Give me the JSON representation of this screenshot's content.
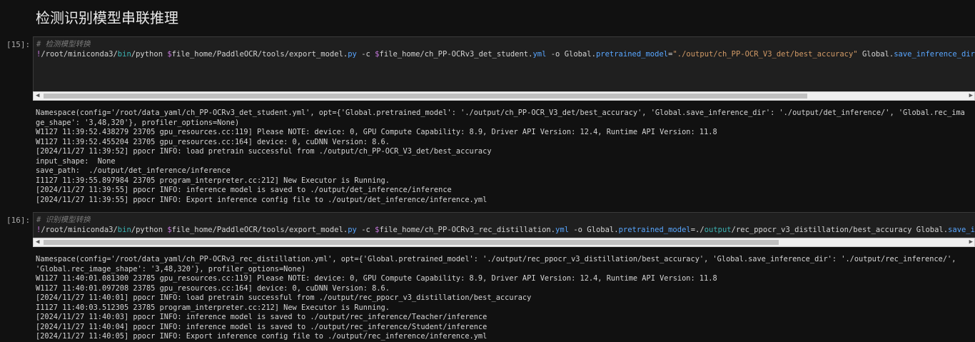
{
  "heading": "检测识别模型串联推理",
  "cells": [
    {
      "prompt": "[15]:",
      "comment": "# 检测模型转换",
      "tokens": [
        {
          "t": "!",
          "c": "bang"
        },
        {
          "t": "/root/miniconda3/",
          "c": "path"
        },
        {
          "t": "bin",
          "c": "dir"
        },
        {
          "t": "/python ",
          "c": "path"
        },
        {
          "t": "$",
          "c": "bang"
        },
        {
          "t": "file_home/PaddleOCR/tools/export_model.",
          "c": "path"
        },
        {
          "t": "py",
          "c": "ext"
        },
        {
          "t": " -c ",
          "c": "opt"
        },
        {
          "t": "$",
          "c": "bang"
        },
        {
          "t": "file_home/ch_PP-OCRv3_det_student.",
          "c": "path"
        },
        {
          "t": "yml",
          "c": "ext"
        },
        {
          "t": " -o Global.",
          "c": "opt"
        },
        {
          "t": "pretrained_model",
          "c": "prop"
        },
        {
          "t": "=",
          "c": "opt"
        },
        {
          "t": "\"./output/ch_PP-OCR_V3_det/best_accuracy\"",
          "c": "str"
        },
        {
          "t": " Global.",
          "c": "opt"
        },
        {
          "t": "save_inference_dir",
          "c": "prop"
        },
        {
          "t": "=\"",
          "c": "str"
        }
      ],
      "output": [
        "Namespace(config='/root/data_yaml/ch_PP-OCRv3_det_student.yml', opt={'Global.pretrained_model': './output/ch_PP-OCR_V3_det/best_accuracy', 'Global.save_inference_dir': './output/det_inference/', 'Global.rec_ima",
        "ge_shape': '3,48,320'}, profiler_options=None)",
        "W1127 11:39:52.438279 23705 gpu_resources.cc:119] Please NOTE: device: 0, GPU Compute Capability: 8.9, Driver API Version: 12.4, Runtime API Version: 11.8",
        "W1127 11:39:52.455204 23705 gpu_resources.cc:164] device: 0, cuDNN Version: 8.6.",
        "[2024/11/27 11:39:52] ppocr INFO: load pretrain successful from ./output/ch_PP-OCR_V3_det/best_accuracy",
        "input_shape:  None",
        "save_path:  ./output/det_inference/inference",
        "I1127 11:39:55.897984 23705 program_interpreter.cc:212] New Executor is Running.",
        "[2024/11/27 11:39:55] ppocr INFO: inference model is saved to ./output/det_inference/inference",
        "[2024/11/27 11:39:55] ppocr INFO: Export inference config file to ./output/det_inference/inference.yml"
      ]
    },
    {
      "prompt": "[16]:",
      "comment": "# 识别模型转换",
      "tokens": [
        {
          "t": "!",
          "c": "bang"
        },
        {
          "t": "/root/miniconda3/",
          "c": "path"
        },
        {
          "t": "bin",
          "c": "dir"
        },
        {
          "t": "/python ",
          "c": "path"
        },
        {
          "t": "$",
          "c": "bang"
        },
        {
          "t": "file_home/PaddleOCR/tools/export_model.",
          "c": "path"
        },
        {
          "t": "py",
          "c": "ext"
        },
        {
          "t": " -c ",
          "c": "opt"
        },
        {
          "t": "$",
          "c": "bang"
        },
        {
          "t": "file_home/ch_PP-OCRv3_rec_distillation.",
          "c": "path"
        },
        {
          "t": "yml",
          "c": "ext"
        },
        {
          "t": " -o Global.",
          "c": "opt"
        },
        {
          "t": "pretrained_model",
          "c": "prop"
        },
        {
          "t": "=./",
          "c": "opt"
        },
        {
          "t": "output",
          "c": "dir"
        },
        {
          "t": "/rec_ppocr_v3_distillation/best_accuracy Global.",
          "c": "opt"
        },
        {
          "t": "save_infe",
          "c": "prop"
        }
      ],
      "output": [
        "Namespace(config='/root/data_yaml/ch_PP-OCRv3_rec_distillation.yml', opt={'Global.pretrained_model': './output/rec_ppocr_v3_distillation/best_accuracy', 'Global.save_inference_dir': './output/rec_inference/',",
        "'Global.rec_image_shape': '3,48,320'}, profiler_options=None)",
        "W1127 11:40:01.081300 23785 gpu_resources.cc:119] Please NOTE: device: 0, GPU Compute Capability: 8.9, Driver API Version: 12.4, Runtime API Version: 11.8",
        "W1127 11:40:01.097208 23785 gpu_resources.cc:164] device: 0, cuDNN Version: 8.6.",
        "[2024/11/27 11:40:01] ppocr INFO: load pretrain successful from ./output/rec_ppocr_v3_distillation/best_accuracy",
        "I1127 11:40:03.512305 23785 program_interpreter.cc:212] New Executor is Running.",
        "[2024/11/27 11:40:03] ppocr INFO: inference model is saved to ./output/rec_inference/Teacher/inference",
        "[2024/11/27 11:40:04] ppocr INFO: inference model is saved to ./output/rec_inference/Student/inference",
        "[2024/11/27 11:40:05] ppocr INFO: Export inference config file to ./output/rec_inference/inference.yml"
      ]
    }
  ]
}
